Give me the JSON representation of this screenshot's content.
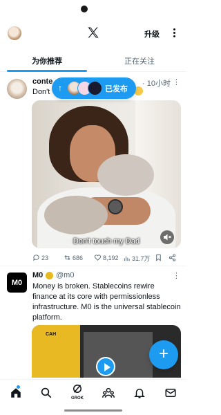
{
  "header": {
    "upgrade_label": "升级"
  },
  "tabs": [
    {
      "label": "为你推荐",
      "active": true
    },
    {
      "label": "正在关注",
      "active": false
    }
  ],
  "posted_pill": {
    "label": "已发布"
  },
  "post1": {
    "username": "conte",
    "time": "· 10小时",
    "text": "Don't",
    "caption": "Don't touch my Dad",
    "stats": {
      "replies": "23",
      "reposts": "686",
      "likes": "8,192",
      "views": "31.7万"
    }
  },
  "post2": {
    "avatar_text": "M0",
    "username": "M0",
    "handle": "@m0",
    "text": "Money is broken. Stablecoins rewire finance at its core with  permissionless infrastructure. M0 is the universal stablecoin platform.",
    "media_label": "CAH"
  },
  "nav": {
    "grok_label": "GROK"
  },
  "colors": {
    "accent": "#1d9bf0",
    "text": "#0f1419",
    "muted": "#536471"
  }
}
